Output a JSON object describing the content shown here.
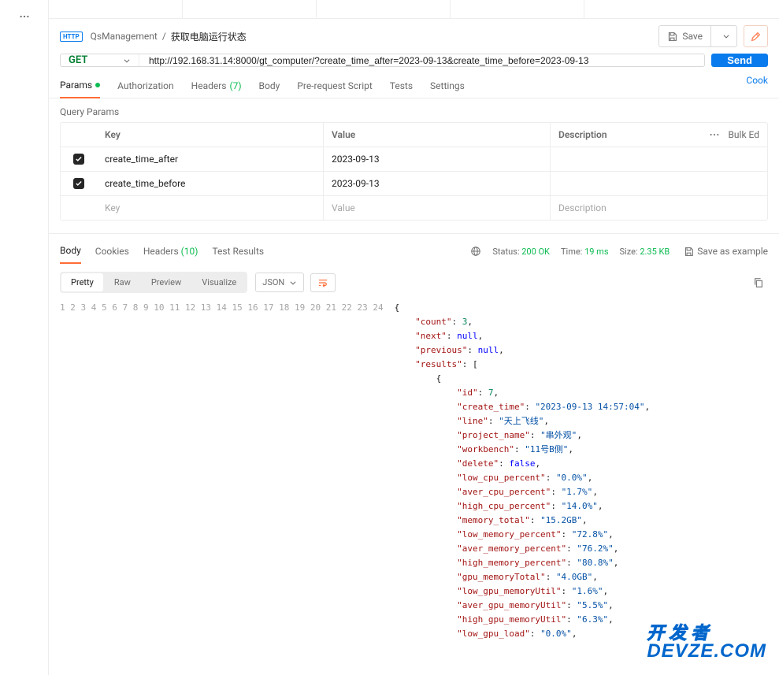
{
  "breadcrumb": {
    "http_badge": "HTTP",
    "collection": "QsManagement",
    "separator": "/",
    "request_name": "获取电脑运行状态"
  },
  "actions": {
    "save": "Save",
    "send": "Send"
  },
  "request": {
    "method": "GET",
    "url": "http://192.168.31.14:8000/gt_computer/?create_time_after=2023-09-13&create_time_before=2023-09-13"
  },
  "req_tabs": {
    "params": "Params",
    "auth": "Authorization",
    "headers": "Headers",
    "headers_count": "(7)",
    "body": "Body",
    "prereq": "Pre-request Script",
    "tests": "Tests",
    "settings": "Settings",
    "cookies": "Cook"
  },
  "query_params": {
    "title": "Query Params",
    "col_key": "Key",
    "col_value": "Value",
    "col_desc": "Description",
    "bulk_edit": "Bulk Ed",
    "rows": [
      {
        "key": "create_time_after",
        "value": "2023-09-13"
      },
      {
        "key": "create_time_before",
        "value": "2023-09-13"
      }
    ],
    "ph_key": "Key",
    "ph_value": "Value",
    "ph_desc": "Description"
  },
  "resp_tabs": {
    "body": "Body",
    "cookies": "Cookies",
    "headers": "Headers",
    "headers_count": "(10)",
    "tests": "Test Results"
  },
  "status": {
    "status_label": "Status:",
    "status_value": "200 OK",
    "time_label": "Time:",
    "time_value": "19 ms",
    "size_label": "Size:",
    "size_value": "2.35 KB",
    "save_example": "Save as example"
  },
  "view": {
    "pretty": "Pretty",
    "raw": "Raw",
    "preview": "Preview",
    "visualize": "Visualize",
    "format": "JSON"
  },
  "code_lines": [
    {
      "n": 1,
      "indent": 0,
      "tokens": [
        [
          "punc",
          "{"
        ]
      ]
    },
    {
      "n": 2,
      "indent": 1,
      "tokens": [
        [
          "key",
          "\"count\""
        ],
        [
          "punc",
          ": "
        ],
        [
          "num",
          "3"
        ],
        [
          "punc",
          ","
        ]
      ]
    },
    {
      "n": 3,
      "indent": 1,
      "tokens": [
        [
          "key",
          "\"next\""
        ],
        [
          "punc",
          ": "
        ],
        [
          "null",
          "null"
        ],
        [
          "punc",
          ","
        ]
      ]
    },
    {
      "n": 4,
      "indent": 1,
      "tokens": [
        [
          "key",
          "\"previous\""
        ],
        [
          "punc",
          ": "
        ],
        [
          "null",
          "null"
        ],
        [
          "punc",
          ","
        ]
      ]
    },
    {
      "n": 5,
      "indent": 1,
      "tokens": [
        [
          "key",
          "\"results\""
        ],
        [
          "punc",
          ": ["
        ]
      ]
    },
    {
      "n": 6,
      "indent": 2,
      "tokens": [
        [
          "punc",
          "{"
        ]
      ]
    },
    {
      "n": 7,
      "indent": 3,
      "tokens": [
        [
          "key",
          "\"id\""
        ],
        [
          "punc",
          ": "
        ],
        [
          "num",
          "7"
        ],
        [
          "punc",
          ","
        ]
      ]
    },
    {
      "n": 8,
      "indent": 3,
      "tokens": [
        [
          "key",
          "\"create_time\""
        ],
        [
          "punc",
          ": "
        ],
        [
          "str",
          "\"2023-09-13 14:57:04\""
        ],
        [
          "punc",
          ","
        ]
      ]
    },
    {
      "n": 9,
      "indent": 3,
      "tokens": [
        [
          "key",
          "\"line\""
        ],
        [
          "punc",
          ": "
        ],
        [
          "str",
          "\"天上飞线\""
        ],
        [
          "punc",
          ","
        ]
      ]
    },
    {
      "n": 10,
      "indent": 3,
      "tokens": [
        [
          "key",
          "\"project_name\""
        ],
        [
          "punc",
          ": "
        ],
        [
          "str",
          "\"串外观\""
        ],
        [
          "punc",
          ","
        ]
      ]
    },
    {
      "n": 11,
      "indent": 3,
      "tokens": [
        [
          "key",
          "\"workbench\""
        ],
        [
          "punc",
          ": "
        ],
        [
          "str",
          "\"11号B侧\""
        ],
        [
          "punc",
          ","
        ]
      ]
    },
    {
      "n": 12,
      "indent": 3,
      "tokens": [
        [
          "key",
          "\"delete\""
        ],
        [
          "punc",
          ": "
        ],
        [
          "bool",
          "false"
        ],
        [
          "punc",
          ","
        ]
      ]
    },
    {
      "n": 13,
      "indent": 3,
      "tokens": [
        [
          "key",
          "\"low_cpu_percent\""
        ],
        [
          "punc",
          ": "
        ],
        [
          "str",
          "\"0.0%\""
        ],
        [
          "punc",
          ","
        ]
      ]
    },
    {
      "n": 14,
      "indent": 3,
      "tokens": [
        [
          "key",
          "\"aver_cpu_percent\""
        ],
        [
          "punc",
          ": "
        ],
        [
          "str",
          "\"1.7%\""
        ],
        [
          "punc",
          ","
        ]
      ]
    },
    {
      "n": 15,
      "indent": 3,
      "tokens": [
        [
          "key",
          "\"high_cpu_percent\""
        ],
        [
          "punc",
          ": "
        ],
        [
          "str",
          "\"14.0%\""
        ],
        [
          "punc",
          ","
        ]
      ]
    },
    {
      "n": 16,
      "indent": 3,
      "tokens": [
        [
          "key",
          "\"memory_total\""
        ],
        [
          "punc",
          ": "
        ],
        [
          "str",
          "\"15.2GB\""
        ],
        [
          "punc",
          ","
        ]
      ]
    },
    {
      "n": 17,
      "indent": 3,
      "tokens": [
        [
          "key",
          "\"low_memory_percent\""
        ],
        [
          "punc",
          ": "
        ],
        [
          "str",
          "\"72.8%\""
        ],
        [
          "punc",
          ","
        ]
      ]
    },
    {
      "n": 18,
      "indent": 3,
      "tokens": [
        [
          "key",
          "\"aver_memory_percent\""
        ],
        [
          "punc",
          ": "
        ],
        [
          "str",
          "\"76.2%\""
        ],
        [
          "punc",
          ","
        ]
      ]
    },
    {
      "n": 19,
      "indent": 3,
      "tokens": [
        [
          "key",
          "\"high_memory_percent\""
        ],
        [
          "punc",
          ": "
        ],
        [
          "str",
          "\"80.8%\""
        ],
        [
          "punc",
          ","
        ]
      ]
    },
    {
      "n": 20,
      "indent": 3,
      "tokens": [
        [
          "key",
          "\"gpu_memoryTotal\""
        ],
        [
          "punc",
          ": "
        ],
        [
          "str",
          "\"4.0GB\""
        ],
        [
          "punc",
          ","
        ]
      ]
    },
    {
      "n": 21,
      "indent": 3,
      "tokens": [
        [
          "key",
          "\"low_gpu_memoryUtil\""
        ],
        [
          "punc",
          ": "
        ],
        [
          "str",
          "\"1.6%\""
        ],
        [
          "punc",
          ","
        ]
      ]
    },
    {
      "n": 22,
      "indent": 3,
      "tokens": [
        [
          "key",
          "\"aver_gpu_memoryUtil\""
        ],
        [
          "punc",
          ": "
        ],
        [
          "str",
          "\"5.5%\""
        ],
        [
          "punc",
          ","
        ]
      ]
    },
    {
      "n": 23,
      "indent": 3,
      "tokens": [
        [
          "key",
          "\"high_gpu_memoryUtil\""
        ],
        [
          "punc",
          ": "
        ],
        [
          "str",
          "\"6.3%\""
        ],
        [
          "punc",
          ","
        ]
      ]
    },
    {
      "n": 24,
      "indent": 3,
      "tokens": [
        [
          "key",
          "\"low_gpu_load\""
        ],
        [
          "punc",
          ": "
        ],
        [
          "str",
          "\"0.0%\""
        ],
        [
          "punc",
          ","
        ]
      ]
    }
  ],
  "watermark": {
    "line1": "开发者",
    "line2": "DEVZE.COM"
  }
}
